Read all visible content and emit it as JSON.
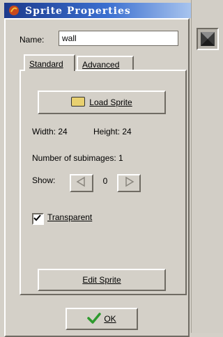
{
  "window": {
    "title": "Sprite Properties"
  },
  "name_field": {
    "label": "Name:",
    "value": "wall"
  },
  "tabs": [
    {
      "label": "Standard"
    },
    {
      "label": "Advanced"
    }
  ],
  "standard": {
    "load_button": "Load Sprite",
    "width": "Width: 24",
    "height": "Height: 24",
    "subimages": "Number of subimages: 1",
    "show_label": "Show:",
    "show_value": "0",
    "transparent_label": "Transparent",
    "transparent_checked": true,
    "edit_button": "Edit Sprite"
  },
  "ok_button": "OK",
  "colors": {
    "title_start": "#1d3a8c",
    "title_end": "#a8c4ee",
    "ok_check": "#2e9a2e"
  }
}
